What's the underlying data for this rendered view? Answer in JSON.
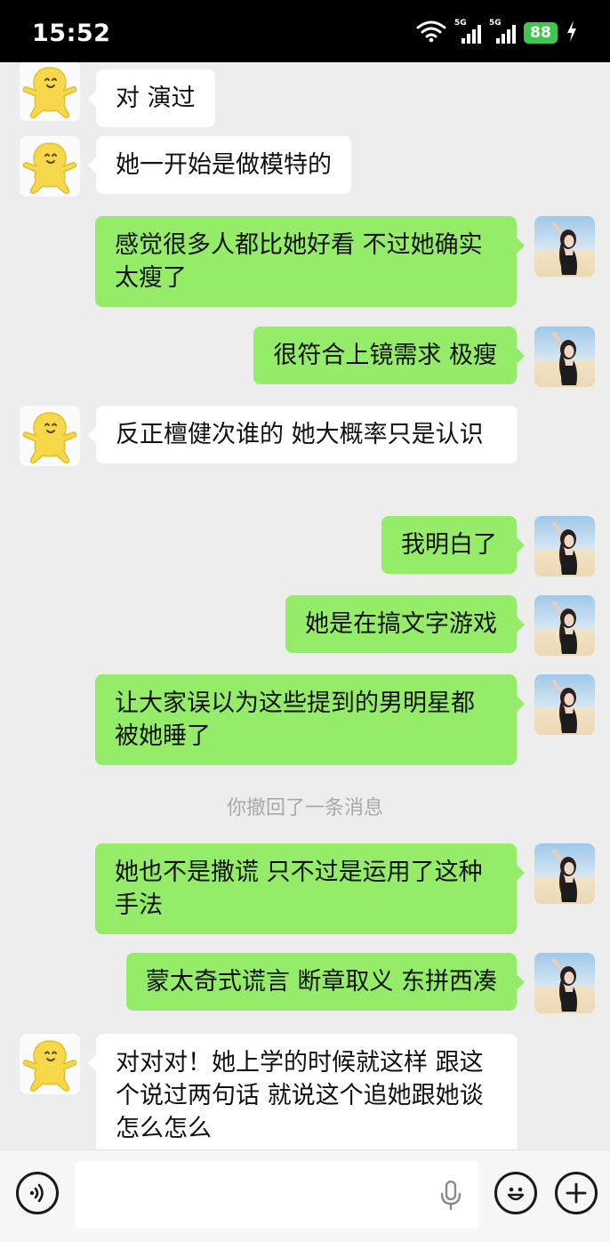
{
  "status_bar": {
    "time": "15:52",
    "signal_1_label": "5G",
    "signal_2_label": "5G",
    "battery_level": "88",
    "icons": [
      "wifi-icon",
      "signal-icon",
      "signal-icon",
      "battery-icon",
      "charging-icon"
    ]
  },
  "messages": [
    {
      "side": "in",
      "text": "对 演过"
    },
    {
      "side": "in",
      "text": "她一开始是做模特的"
    },
    {
      "side": "out",
      "text": "感觉很多人都比她好看 不过她确实太瘦了"
    },
    {
      "side": "out",
      "text": "很符合上镜需求 极瘦"
    },
    {
      "side": "in",
      "text": "反正檀健次谁的 她大概率只是认识"
    },
    {
      "side": "out",
      "text": "我明白了"
    },
    {
      "side": "out",
      "text": "她是在搞文字游戏"
    },
    {
      "side": "out",
      "text": "让大家误以为这些提到的男明星都被她睡了"
    },
    {
      "side": "system",
      "text": "你撤回了一条消息"
    },
    {
      "side": "out",
      "text": "她也不是撒谎 只不过是运用了这种手法"
    },
    {
      "side": "out",
      "text": "蒙太奇式谎言 断章取义 东拼西凑"
    },
    {
      "side": "in",
      "text": "对对对！她上学的时候就这样 跟这个说过两句话 就说这个追她跟她谈怎么怎么"
    }
  ],
  "input_bar": {
    "text_value": "",
    "icons": [
      "voice-icon",
      "microphone-icon",
      "emoji-icon",
      "plus-icon"
    ]
  },
  "colors": {
    "background": "#ededed",
    "incoming_bubble": "#ffffff",
    "outgoing_bubble": "#95ec69",
    "system_text": "#a9a9a9",
    "battery": "#3ec64f"
  }
}
